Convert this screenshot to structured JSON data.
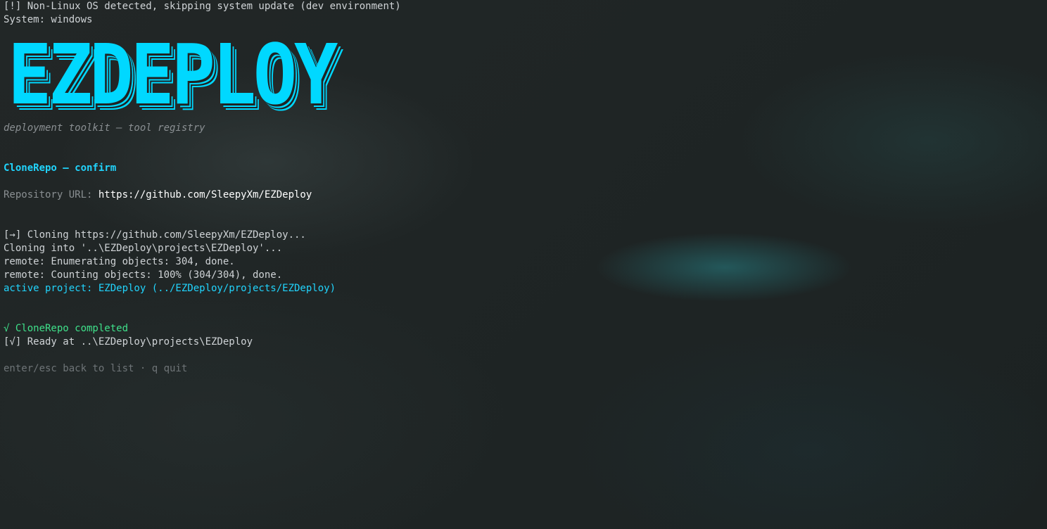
{
  "terminal": {
    "warn_line": "[!] Non-Linux OS detected, skipping system update (dev environment)",
    "system_line": "System: windows",
    "banner": "EZDEPLOY",
    "tagline": "deployment toolkit — tool registry",
    "section_title": "CloneRepo — confirm",
    "repo_label": "Repository URL: ",
    "repo_value": "https://github.com/SleepyXm/EZDeploy",
    "log": [
      "[→] Cloning https://github.com/SleepyXm/EZDeploy...",
      "Cloning into '..\\EZDeploy\\projects\\EZDeploy'...",
      "remote: Enumerating objects: 304, done.",
      "remote: Counting objects: 100% (304/304), done."
    ],
    "active_project": "active project: EZDeploy (../EZDeploy/projects/EZDeploy)",
    "completed": "√ CloneRepo completed",
    "ready": "[√] Ready at ..\\EZDeploy\\projects\\EZDeploy",
    "footer_hint": "enter/esc back to list · q quit"
  },
  "colors": {
    "accent_cyan": "#21d4fd",
    "success_green": "#3fe08a",
    "text": "#cfd3d6",
    "dim": "#8a8f92"
  }
}
